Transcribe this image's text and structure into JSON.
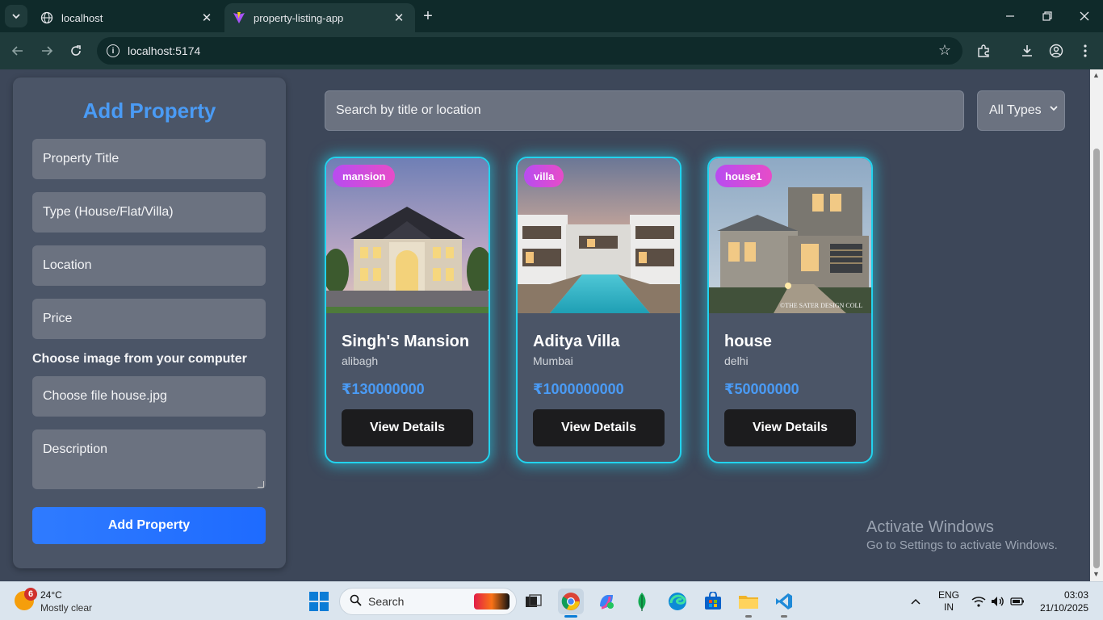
{
  "browser": {
    "tabs": [
      {
        "title": "localhost",
        "active": false
      },
      {
        "title": "property-listing-app",
        "active": true
      }
    ],
    "url": "localhost:5174"
  },
  "form": {
    "heading": "Add Property",
    "title_placeholder": "Property Title",
    "type_placeholder": "Type (House/Flat/Villa)",
    "location_placeholder": "Location",
    "price_placeholder": "Price",
    "image_label": "Choose image from your computer",
    "file_value": "Choose file house.jpg",
    "description_placeholder": "Description",
    "submit_label": "Add Property"
  },
  "filters": {
    "search_placeholder": "Search by title or location",
    "type_selected": "All Types"
  },
  "properties": [
    {
      "badge": "mansion",
      "name": "Singh's Mansion",
      "location": "alibagh",
      "price": "₹130000000",
      "button": "View Details"
    },
    {
      "badge": "villa",
      "name": "Aditya Villa",
      "location": "Mumbai",
      "price": "₹1000000000",
      "button": "View Details"
    },
    {
      "badge": "house1",
      "name": "house",
      "location": "delhi",
      "price": "₹50000000",
      "button": "View Details",
      "photo_watermark": "©THE SATER DESIGN COLL"
    }
  ],
  "watermark": {
    "line1": "Activate Windows",
    "line2": "Go to Settings to activate Windows."
  },
  "taskbar": {
    "weather_badge": "6",
    "weather_temp": "24°C",
    "weather_cond": "Mostly clear",
    "search_label": "Search",
    "lang_line1": "ENG",
    "lang_line2": "IN",
    "time": "03:03",
    "date": "21/10/2025"
  },
  "colors": {
    "accent_blue": "#4a9bf5",
    "card_glow": "#22d3ee",
    "badge_gradient": [
      "#b84cf0",
      "#e74cc8"
    ],
    "page_bg": "#3d4759"
  }
}
